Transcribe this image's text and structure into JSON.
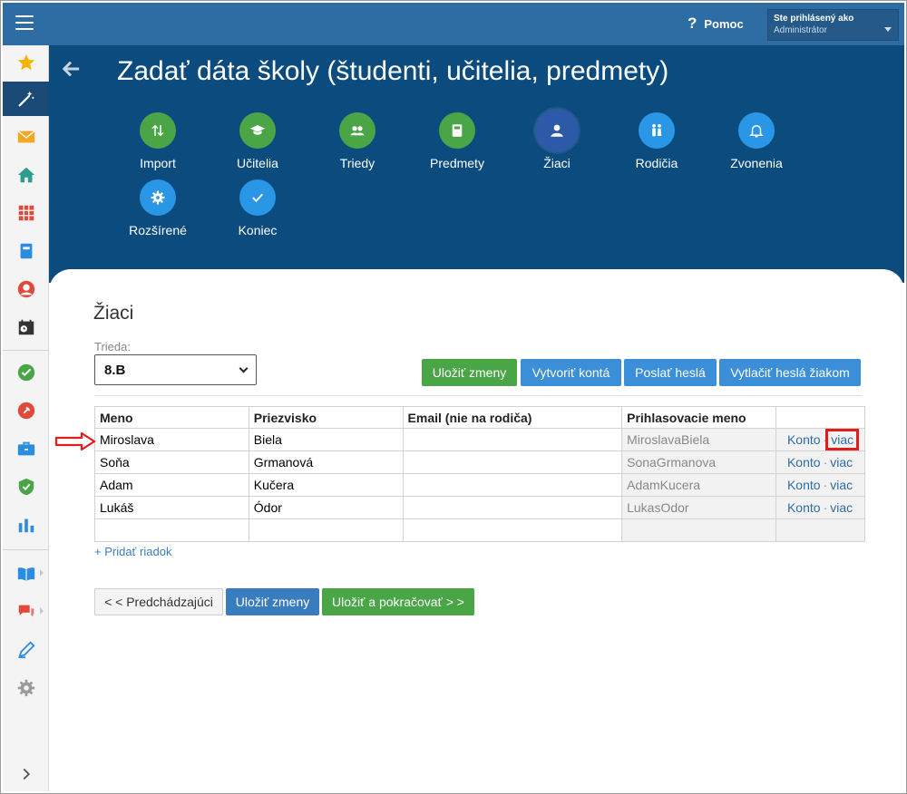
{
  "topbar": {
    "help_label": "Pomoc",
    "user_line1": "Ste prihlásený ako",
    "user_line2": "Administrátor"
  },
  "header": {
    "title": "Zadať dáta školy (študenti, učitelia, predmety)",
    "steps": [
      {
        "label": "Import",
        "icon": "arrows-updown-icon",
        "color": "green"
      },
      {
        "label": "Učitelia",
        "icon": "graduation-cap-icon",
        "color": "green"
      },
      {
        "label": "Triedy",
        "icon": "users-icon",
        "color": "green"
      },
      {
        "label": "Predmety",
        "icon": "book-icon",
        "color": "green"
      },
      {
        "label": "Žiaci",
        "icon": "user-icon",
        "color": "active"
      },
      {
        "label": "Rodičia",
        "icon": "parents-icon",
        "color": "blue"
      },
      {
        "label": "Zvonenia",
        "icon": "bell-icon",
        "color": "blue"
      },
      {
        "label": "Rozšírené",
        "icon": "gear-icon",
        "color": "blue"
      },
      {
        "label": "Koniec",
        "icon": "check-icon",
        "color": "blue"
      }
    ]
  },
  "main": {
    "section_title": "Žiaci",
    "trieda_label": "Trieda:",
    "trieda_value": "8.B",
    "buttons": {
      "save": "Uložiť zmeny",
      "create_accounts": "Vytvoriť kontá",
      "send_passwords": "Poslať heslá",
      "print_passwords": "Vytlačiť heslá žiakom"
    },
    "table": {
      "headers": [
        "Meno",
        "Priezvisko",
        "Email (nie na rodiča)",
        "Prihlasovacie meno",
        ""
      ],
      "rows": [
        {
          "meno": "Miroslava",
          "priezvisko": "Biela",
          "email": "",
          "login": "MiroslavaBiela",
          "konto": "Konto",
          "viac": "viac"
        },
        {
          "meno": "Soňa",
          "priezvisko": "Grmanová",
          "email": "",
          "login": "SonaGrmanova",
          "konto": "Konto",
          "viac": "viac"
        },
        {
          "meno": "Adam",
          "priezvisko": "Kučera",
          "email": "",
          "login": "AdamKucera",
          "konto": "Konto",
          "viac": "viac"
        },
        {
          "meno": "Lukáš",
          "priezvisko": "Ódor",
          "email": "",
          "login": "LukasOdor",
          "konto": "Konto",
          "viac": "viac"
        }
      ]
    },
    "add_row": "+ Pridať riadok",
    "nav": {
      "prev": "< < Predchádzajúci",
      "save": "Uložiť zmeny",
      "save_continue": "Uložiť a pokračovať > >"
    }
  },
  "sidebar": {
    "items": [
      "star-icon",
      "magic-wand-icon",
      "mail-icon",
      "home-icon",
      "timetable-icon",
      "notebook-icon",
      "person-icon",
      "calendar-icon",
      "check-circle-icon",
      "pin-icon",
      "briefcase-icon",
      "shield-icon",
      "bar-chart-icon",
      "open-book-icon",
      "chat-icon",
      "pencil-icon",
      "gear-icon",
      "expand-icon"
    ]
  },
  "colors": {
    "topbar": "#2e6da4",
    "header": "#0b4b7d",
    "green": "#4aa547",
    "blue": "#3a8fd8",
    "highlight": "#e21b1b"
  }
}
